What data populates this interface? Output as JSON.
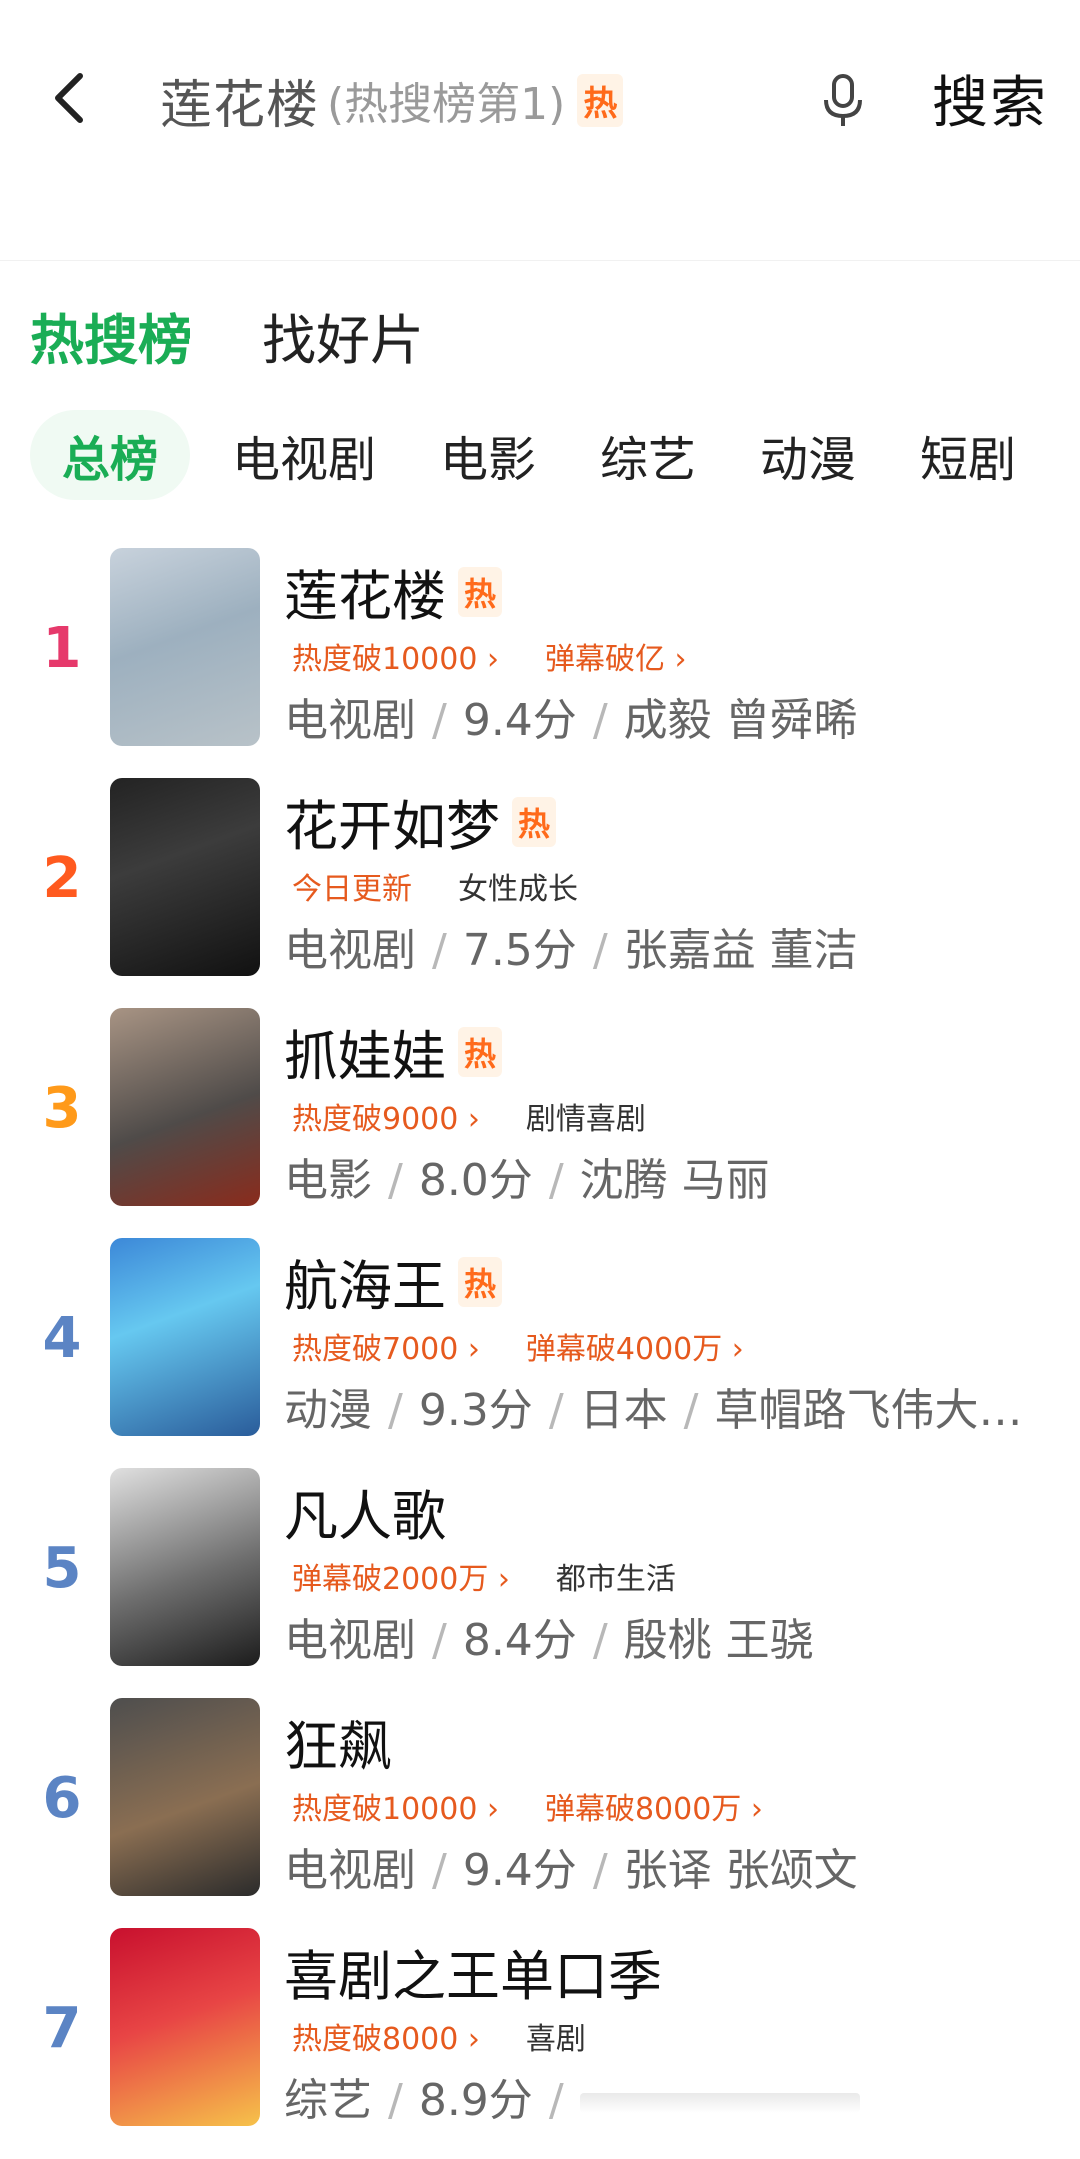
{
  "header": {
    "search_main": "莲花楼",
    "search_sub": "(热搜榜第1)",
    "hot_badge": "热",
    "search_button": "搜索"
  },
  "main_tabs": [
    {
      "label": "热搜榜",
      "active": true
    },
    {
      "label": "找好片",
      "active": false
    }
  ],
  "categories": [
    "总榜",
    "电视剧",
    "电影",
    "综艺",
    "动漫",
    "短剧"
  ],
  "colors": {
    "accent_green": "#1aad55",
    "tag_orange": "#e65a1e",
    "rank1": "#e6396b",
    "rank2": "#ff5a1f",
    "rank3": "#ff9a1a",
    "rank_other": "#5b84c4"
  },
  "items": [
    {
      "rank": "1",
      "title": "莲花楼",
      "hot": "热",
      "tag1": "热度破10000 ›",
      "tag2": "弹幕破亿 ›",
      "type": "电视剧",
      "score": "9.4分",
      "extra": "成毅 曾舜晞",
      "extra2": ""
    },
    {
      "rank": "2",
      "title": "花开如梦",
      "hot": "热",
      "tag1": "今日更新",
      "tag2": "女性成长",
      "type": "电视剧",
      "score": "7.5分",
      "extra": "张嘉益 董洁",
      "extra2": ""
    },
    {
      "rank": "3",
      "title": "抓娃娃",
      "hot": "热",
      "tag1": "热度破9000 ›",
      "tag2": "剧情喜剧",
      "type": "电影",
      "score": "8.0分",
      "extra": "沈腾 马丽",
      "extra2": ""
    },
    {
      "rank": "4",
      "title": "航海王",
      "hot": "热",
      "tag1": "热度破7000 ›",
      "tag2": "弹幕破4000万 ›",
      "type": "动漫",
      "score": "9.3分",
      "extra": "日本",
      "extra2": "草帽路飞伟大…"
    },
    {
      "rank": "5",
      "title": "凡人歌",
      "hot": "",
      "tag1": "弹幕破2000万 ›",
      "tag2": "都市生活",
      "type": "电视剧",
      "score": "8.4分",
      "extra": "殷桃 王骁",
      "extra2": ""
    },
    {
      "rank": "6",
      "title": "狂飙",
      "hot": "",
      "tag1": "热度破10000 ›",
      "tag2": "弹幕破8000万 ›",
      "type": "电视剧",
      "score": "9.4分",
      "extra": "张译 张颂文",
      "extra2": ""
    },
    {
      "rank": "7",
      "title": "喜剧之王单口季",
      "hot": "",
      "tag1": "热度破8000 ›",
      "tag2": "喜剧",
      "type": "综艺",
      "score": "8.9分",
      "extra": "",
      "extra2": ""
    }
  ]
}
